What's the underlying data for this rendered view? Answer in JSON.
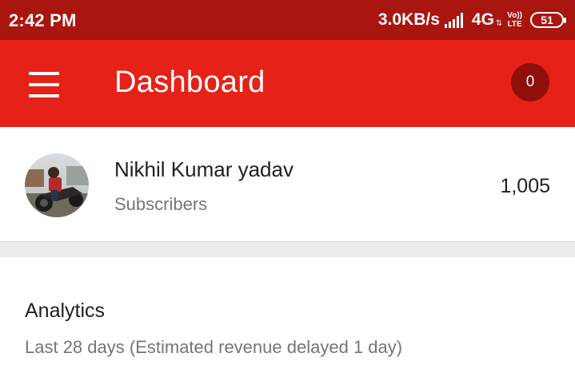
{
  "status_bar": {
    "time": "2:42 PM",
    "net_speed": "3.0KB/s",
    "net_type": "4G",
    "volte_top": "Vo))",
    "volte_bottom": "LTE",
    "battery": "51",
    "signal_icon": "signal-bars-icon",
    "battery_icon": "battery-icon"
  },
  "app_bar": {
    "title": "Dashboard",
    "menu_icon": "hamburger-menu-icon",
    "notification_count": "0",
    "background_color": "#e62117",
    "badge_color": "#8f0f0a"
  },
  "channel": {
    "name": "Nikhil Kumar yadav",
    "subscribers_label": "Subscribers",
    "subscriber_count": "1,005",
    "avatar_icon": "channel-avatar"
  },
  "analytics": {
    "title": "Analytics",
    "subtitle": "Last 28 days (Estimated revenue delayed 1 day)"
  }
}
